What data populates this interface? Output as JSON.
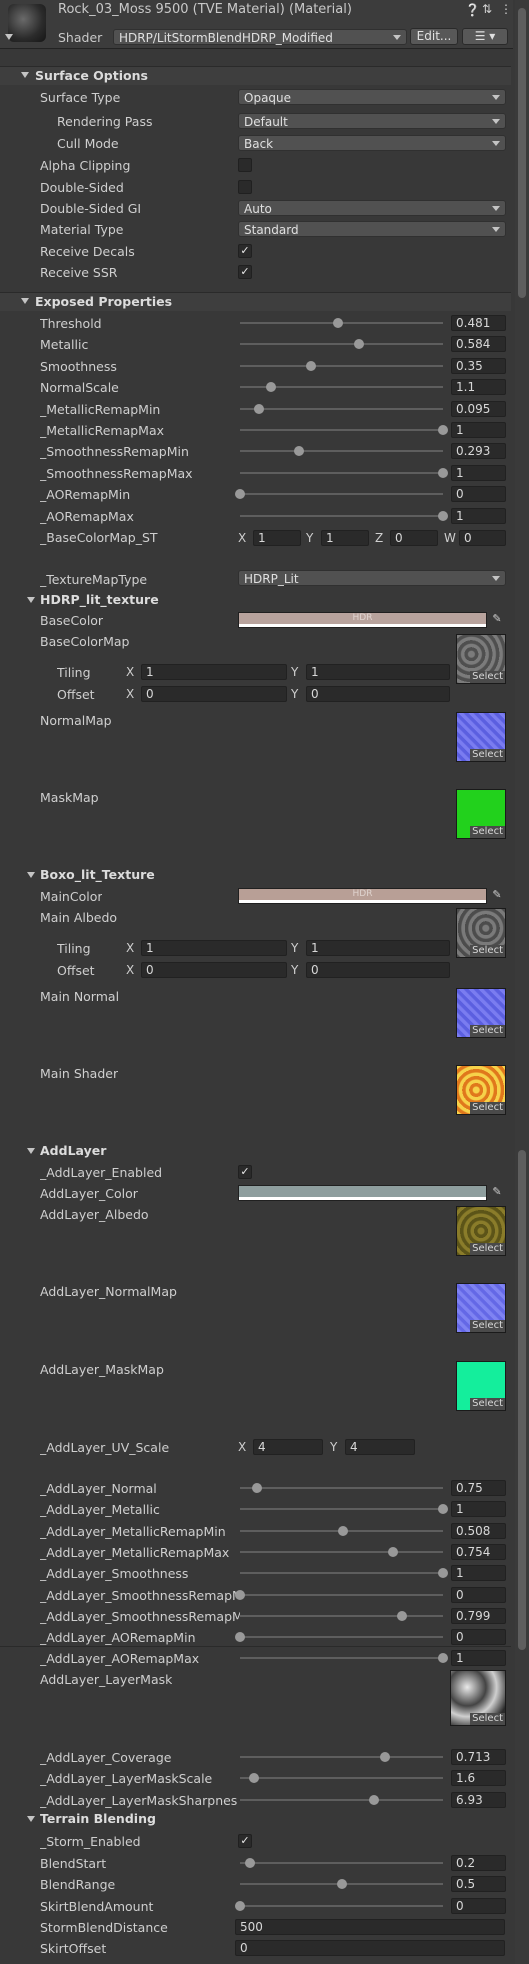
{
  "header": {
    "title": "Rock_03_Moss 9500 (TVE Material) (Material)",
    "shader_label": "Shader",
    "shader_value": "HDRP/LitStormBlendHDRP_Modified",
    "edit_button": "Edit...",
    "help_icon": "help-icon",
    "settings_icon": "settings-icon",
    "more_icon": "more-icon",
    "list_icon": "list-icon"
  },
  "surface_options": {
    "title": "Surface Options",
    "surface_type": {
      "label": "Surface Type",
      "value": "Opaque"
    },
    "rendering_pass": {
      "label": "Rendering Pass",
      "value": "Default"
    },
    "cull_mode": {
      "label": "Cull Mode",
      "value": "Back"
    },
    "alpha_clipping": {
      "label": "Alpha Clipping",
      "checked": false
    },
    "double_sided": {
      "label": "Double-Sided",
      "checked": false
    },
    "double_sided_gi": {
      "label": "Double-Sided GI",
      "value": "Auto"
    },
    "material_type": {
      "label": "Material Type",
      "value": "Standard"
    },
    "receive_decals": {
      "label": "Receive Decals",
      "checked": true
    },
    "receive_ssr": {
      "label": "Receive SSR",
      "checked": true
    }
  },
  "exposed": {
    "title": "Exposed Properties",
    "sliders": [
      {
        "label": "Threshold",
        "value": "0.481",
        "level": 0.481
      },
      {
        "label": "Metallic",
        "value": "0.584",
        "level": 0.584
      },
      {
        "label": "Smoothness",
        "value": "0.35",
        "level": 0.35
      },
      {
        "label": "NormalScale",
        "value": "1.1",
        "level": 0.155
      },
      {
        "label": "_MetallicRemapMin",
        "value": "0.095",
        "level": 0.095
      },
      {
        "label": "_MetallicRemapMax",
        "value": "1",
        "level": 1
      },
      {
        "label": "_SmoothnessRemapMin",
        "value": "0.293",
        "level": 0.293
      },
      {
        "label": "_SmoothnessRemapMax",
        "value": "1",
        "level": 1
      },
      {
        "label": "_AORemapMin",
        "value": "0",
        "level": 0
      },
      {
        "label": "_AORemapMax",
        "value": "1",
        "level": 1
      }
    ],
    "basecolor_st": {
      "label": "_BaseColorMap_ST",
      "x": "1",
      "y": "1",
      "z": "0",
      "w": "0"
    },
    "texture_map_type": {
      "label": "_TextureMapType",
      "value": "HDRP_Lit"
    }
  },
  "hdrp_lit": {
    "title": "HDRP_lit_texture",
    "basecolor": {
      "label": "BaseColor",
      "hdr": "HDR",
      "color": "#b8a39d"
    },
    "basecolormap": {
      "label": "BaseColorMap"
    },
    "tiling": {
      "label": "Tiling",
      "x": "1",
      "y": "1"
    },
    "offset": {
      "label": "Offset",
      "x": "0",
      "y": "0"
    },
    "normalmap": {
      "label": "NormalMap"
    },
    "maskmap": {
      "label": "MaskMap"
    },
    "select": "Select"
  },
  "boxo": {
    "title": "Boxo_lit_Texture",
    "maincolor": {
      "label": "MainColor",
      "hdr": "HDR",
      "color": "#b89f96"
    },
    "main_albedo": {
      "label": "Main Albedo"
    },
    "tiling": {
      "label": "Tiling",
      "x": "1",
      "y": "1"
    },
    "offset": {
      "label": "Offset",
      "x": "0",
      "y": "0"
    },
    "main_normal": {
      "label": "Main Normal"
    },
    "main_shader": {
      "label": "Main Shader"
    }
  },
  "addlayer": {
    "title": "AddLayer",
    "enabled": {
      "label": "_AddLayer_Enabled",
      "checked": true
    },
    "color": {
      "label": "AddLayer_Color",
      "color": "#8e9e9e"
    },
    "albedo": {
      "label": "AddLayer_Albedo"
    },
    "normalmap": {
      "label": "AddLayer_NormalMap"
    },
    "maskmap": {
      "label": "AddLayer_MaskMap"
    },
    "uv_scale": {
      "label": "_AddLayer_UV_Scale",
      "x": "4",
      "y": "4"
    },
    "sliders": [
      {
        "label": "_AddLayer_Normal",
        "value": "0.75",
        "level": 0.083
      },
      {
        "label": "_AddLayer_Metallic",
        "value": "1",
        "level": 1
      },
      {
        "label": "_AddLayer_MetallicRemapMin",
        "value": "0.508",
        "level": 0.508
      },
      {
        "label": "_AddLayer_MetallicRemapMax",
        "value": "0.754",
        "level": 0.754
      },
      {
        "label": "_AddLayer_Smoothness",
        "value": "1",
        "level": 1
      },
      {
        "label": "_AddLayer_SmoothnessRemapMin",
        "value": "0",
        "level": 0
      },
      {
        "label": "_AddLayer_SmoothnessRemapMax",
        "value": "0.799",
        "level": 0.799
      },
      {
        "label": "_AddLayer_AORemapMin",
        "value": "0",
        "level": 0
      },
      {
        "label": "_AddLayer_AORemapMax",
        "value": "1",
        "level": 1
      }
    ],
    "layermask": {
      "label": "AddLayer_LayerMask"
    },
    "sliders2": [
      {
        "label": "_AddLayer_Coverage",
        "value": "0.713",
        "level": 0.713
      },
      {
        "label": "_AddLayer_LayerMaskScale",
        "value": "1.6",
        "level": 0.067
      },
      {
        "label": "_AddLayer_LayerMaskSharpnes",
        "value": "6.93",
        "level": 0.66
      }
    ]
  },
  "terrain": {
    "title": "Terrain Blending",
    "storm_enabled": {
      "label": "_Storm_Enabled",
      "checked": true
    },
    "sliders": [
      {
        "label": "BlendStart",
        "value": "0.2",
        "level": 0.05
      },
      {
        "label": "BlendRange",
        "value": "0.5",
        "level": 0.5
      },
      {
        "label": "SkirtBlendAmount",
        "value": "0",
        "level": 0
      }
    ],
    "storm_blend_distance": {
      "label": "StormBlendDistance",
      "value": "500"
    },
    "skirt_offset": {
      "label": "SkirtOffset",
      "value": "0"
    }
  }
}
